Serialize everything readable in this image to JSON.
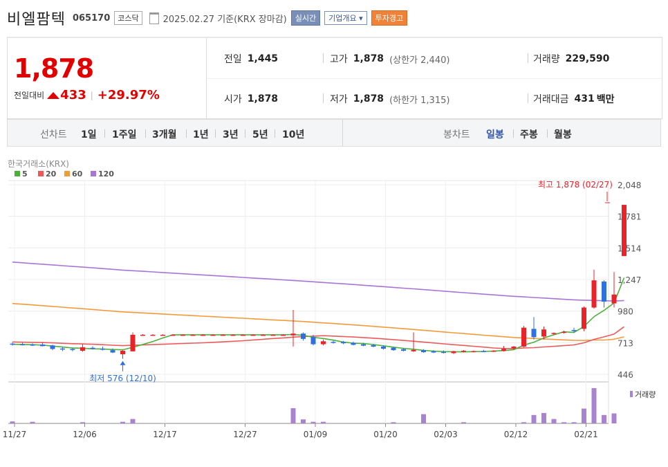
{
  "header": {
    "stock_name": "비엘팜텍",
    "stock_code": "065170",
    "market": "코스닥",
    "date_text": "2025.02.27  기준(KRX 장마감)",
    "realtime_btn": "실시간",
    "company_btn": "기업개요 ▾",
    "warning_btn": "투자경고"
  },
  "price": {
    "current": "1,878",
    "change_label": "전일대비",
    "change_amt": "433",
    "change_pct": "+29.97%",
    "prev_label": "전일",
    "prev": "1,445",
    "high_label": "고가",
    "high": "1,878",
    "upper_limit": "(상한가 2,440)",
    "volume_label": "거래량",
    "volume": "229,590",
    "open_label": "시가",
    "open": "1,878",
    "low_label": "저가",
    "low": "1,878",
    "lower_limit": "(하한가 1,315)",
    "turnover_label": "거래대금",
    "turnover": "431",
    "turnover_unit": "백만"
  },
  "tabs": {
    "line_chart": "선차트",
    "ranges": [
      "1일",
      "1주일",
      "3개월",
      "1년",
      "3년",
      "5년",
      "10년"
    ],
    "candle_chart": "봉차트",
    "periods": [
      "일봉",
      "주봉",
      "월봉"
    ],
    "selected_period": "일봉"
  },
  "chart_data": {
    "type": "candlestick",
    "source": "한국거래소(KRX)",
    "legend": [
      {
        "name": "5",
        "color": "#4caf3c"
      },
      {
        "name": "20",
        "color": "#ea5a5a"
      },
      {
        "name": "60",
        "color": "#f39a3a"
      },
      {
        "name": "120",
        "color": "#a874d8"
      }
    ],
    "y_ticks": [
      2048,
      1781,
      1514,
      1247,
      980,
      713,
      446
    ],
    "ylim": [
      446,
      2048
    ],
    "x_tick_labels": [
      "11/27",
      "12/06",
      "12/17",
      "12/27",
      "01/09",
      "01/20",
      "02/03",
      "02/12",
      "02/21"
    ],
    "max_annotation": "최고 1,878 (02/27)",
    "min_annotation": "최저 576 (12/10)",
    "volume_label": "거래량",
    "colors": {
      "up": "#e8232a",
      "down": "#2f6fe0"
    },
    "candles": [
      {
        "o": 705,
        "h": 715,
        "l": 688,
        "c": 697
      },
      {
        "o": 700,
        "h": 712,
        "l": 690,
        "c": 693
      },
      {
        "o": 697,
        "h": 708,
        "l": 685,
        "c": 690
      },
      {
        "o": 698,
        "h": 718,
        "l": 682,
        "c": 684
      },
      {
        "o": 690,
        "h": 697,
        "l": 650,
        "c": 660
      },
      {
        "o": 664,
        "h": 676,
        "l": 642,
        "c": 655
      },
      {
        "o": 660,
        "h": 670,
        "l": 640,
        "c": 655
      },
      {
        "o": 645,
        "h": 700,
        "l": 637,
        "c": 675
      },
      {
        "o": 670,
        "h": 683,
        "l": 655,
        "c": 661
      },
      {
        "o": 662,
        "h": 680,
        "l": 648,
        "c": 655
      },
      {
        "o": 650,
        "h": 665,
        "l": 625,
        "c": 630
      },
      {
        "o": 615,
        "h": 650,
        "l": 576,
        "c": 645
      },
      {
        "o": 640,
        "h": 800,
        "l": 638,
        "c": 780
      },
      {
        "o": 780,
        "h": 785,
        "l": 778,
        "c": 780
      },
      {
        "o": 780,
        "h": 785,
        "l": 778,
        "c": 780
      },
      {
        "o": 780,
        "h": 785,
        "l": 778,
        "c": 780
      },
      {
        "o": 780,
        "h": 785,
        "l": 778,
        "c": 780
      },
      {
        "o": 780,
        "h": 785,
        "l": 778,
        "c": 780
      },
      {
        "o": 780,
        "h": 785,
        "l": 778,
        "c": 780
      },
      {
        "o": 780,
        "h": 785,
        "l": 778,
        "c": 780
      },
      {
        "o": 780,
        "h": 785,
        "l": 778,
        "c": 780
      },
      {
        "o": 780,
        "h": 785,
        "l": 778,
        "c": 780
      },
      {
        "o": 780,
        "h": 785,
        "l": 778,
        "c": 780
      },
      {
        "o": 780,
        "h": 785,
        "l": 778,
        "c": 780
      },
      {
        "o": 780,
        "h": 785,
        "l": 778,
        "c": 780
      },
      {
        "o": 780,
        "h": 785,
        "l": 778,
        "c": 780
      },
      {
        "o": 780,
        "h": 785,
        "l": 778,
        "c": 780
      },
      {
        "o": 780,
        "h": 785,
        "l": 778,
        "c": 780
      },
      {
        "o": 775,
        "h": 990,
        "l": 680,
        "c": 790
      },
      {
        "o": 790,
        "h": 800,
        "l": 730,
        "c": 745
      },
      {
        "o": 760,
        "h": 780,
        "l": 690,
        "c": 700
      },
      {
        "o": 700,
        "h": 740,
        "l": 690,
        "c": 725
      },
      {
        "o": 720,
        "h": 730,
        "l": 705,
        "c": 715
      },
      {
        "o": 718,
        "h": 728,
        "l": 700,
        "c": 708
      },
      {
        "o": 712,
        "h": 722,
        "l": 690,
        "c": 695
      },
      {
        "o": 700,
        "h": 712,
        "l": 683,
        "c": 688
      },
      {
        "o": 692,
        "h": 703,
        "l": 675,
        "c": 680
      },
      {
        "o": 680,
        "h": 690,
        "l": 655,
        "c": 662
      },
      {
        "o": 670,
        "h": 680,
        "l": 645,
        "c": 650
      },
      {
        "o": 658,
        "h": 668,
        "l": 640,
        "c": 645
      },
      {
        "o": 640,
        "h": 800,
        "l": 635,
        "c": 652
      },
      {
        "o": 650,
        "h": 658,
        "l": 628,
        "c": 633
      },
      {
        "o": 640,
        "h": 650,
        "l": 625,
        "c": 630
      },
      {
        "o": 635,
        "h": 648,
        "l": 622,
        "c": 628
      },
      {
        "o": 625,
        "h": 645,
        "l": 618,
        "c": 640
      },
      {
        "o": 640,
        "h": 650,
        "l": 630,
        "c": 645
      },
      {
        "o": 640,
        "h": 648,
        "l": 632,
        "c": 642
      },
      {
        "o": 643,
        "h": 652,
        "l": 632,
        "c": 640
      },
      {
        "o": 642,
        "h": 650,
        "l": 635,
        "c": 645
      },
      {
        "o": 643,
        "h": 685,
        "l": 638,
        "c": 660
      },
      {
        "o": 665,
        "h": 685,
        "l": 655,
        "c": 680
      },
      {
        "o": 680,
        "h": 855,
        "l": 675,
        "c": 840
      },
      {
        "o": 830,
        "h": 930,
        "l": 740,
        "c": 760
      },
      {
        "o": 765,
        "h": 850,
        "l": 740,
        "c": 825
      },
      {
        "o": 790,
        "h": 800,
        "l": 780,
        "c": 795
      },
      {
        "o": 800,
        "h": 815,
        "l": 790,
        "c": 805
      },
      {
        "o": 820,
        "h": 840,
        "l": 800,
        "c": 815
      },
      {
        "o": 830,
        "h": 1020,
        "l": 810,
        "c": 1010
      },
      {
        "o": 1010,
        "h": 1330,
        "l": 1000,
        "c": 1240
      },
      {
        "o": 1230,
        "h": 1240,
        "l": 1010,
        "c": 1060
      },
      {
        "o": 1045,
        "h": 1310,
        "l": 1010,
        "c": 1120
      },
      {
        "o": 1445,
        "h": 1878,
        "l": 1445,
        "c": 1878
      }
    ],
    "volumes": [
      5,
      0,
      4,
      0,
      0,
      0,
      0,
      3,
      0,
      0,
      0,
      4,
      11,
      0,
      0,
      0,
      0,
      0,
      0,
      0,
      0,
      0,
      0,
      0,
      0,
      0,
      0,
      0,
      38,
      10,
      4,
      4,
      0,
      0,
      0,
      0,
      0,
      0,
      3,
      0,
      0,
      23,
      0,
      0,
      0,
      3,
      0,
      0,
      0,
      0,
      0,
      3,
      21,
      26,
      11,
      3,
      3,
      37,
      88,
      21,
      25,
      0
    ]
  }
}
